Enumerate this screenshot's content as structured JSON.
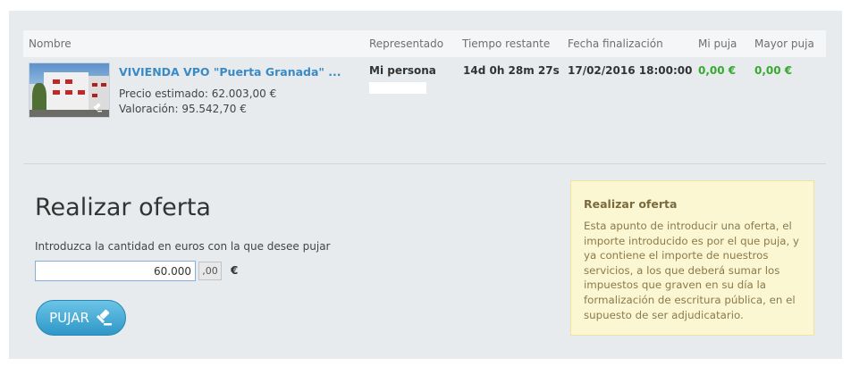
{
  "table": {
    "headers": {
      "nombre": "Nombre",
      "representado": "Representado",
      "tiempo": "Tiempo restante",
      "fecha": "Fecha finalización",
      "mi_puja": "Mi puja",
      "mayor_puja": "Mayor puja"
    },
    "row": {
      "title": "VIVIENDA VPO \"Puerta Granada\" ...",
      "precio": "Precio estimado: 62.003,00 €",
      "valoracion": "Valoración: 95.542,70 €",
      "representado": "Mi persona",
      "tiempo": "14d 0h 28m 27s",
      "fecha": "17/02/2016 18:00:00",
      "mi_puja": "0,00 €",
      "mayor_puja": "0,00 €",
      "thumb_icon": "gavel-icon"
    }
  },
  "offer": {
    "heading": "Realizar oferta",
    "prompt": "Introduzca la cantidad en euros con la que desee pujar",
    "amount_value": "60.000",
    "cents": ",00",
    "currency": "€",
    "button_label": "PUJAR",
    "button_icon": "gavel-icon"
  },
  "info": {
    "title": "Realizar oferta",
    "text": "Esta apunto de introducir una oferta, el importe introducido es por el que puja, y ya contiene el importe de nuestros servicios, a los que deberá sumar los impuestos que graven en su día la formalización de escritura pública, en el supuesto de ser adjudicatario."
  },
  "colors": {
    "link": "#3a8ac4",
    "bid_green": "#38a92f",
    "button": "#2e97c8",
    "info_bg": "#fcf7d3"
  }
}
